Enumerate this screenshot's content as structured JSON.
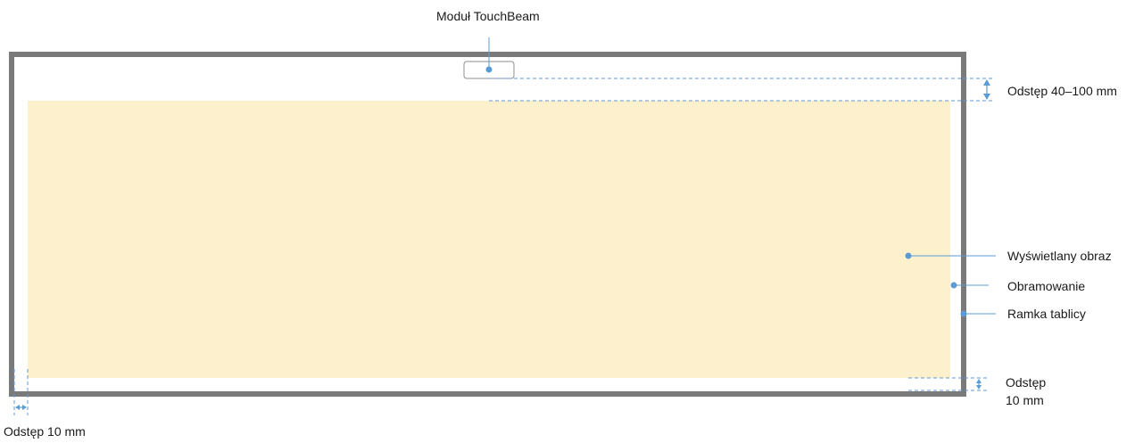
{
  "labels": {
    "touchbeam": "Moduł TouchBeam",
    "gap_top": "Odstęp 40–100 mm",
    "projected_image": "Wyświetlany obraz",
    "border": "Obramowanie",
    "board_frame": "Ramka tablicy",
    "gap_bottom_right_line1": "Odstęp",
    "gap_bottom_right_line2": "10 mm",
    "gap_bottom_left": "Odstęp 10 mm"
  },
  "colors": {
    "frame": "#7a7a7a",
    "image_fill": "#fdf0cd",
    "callout": "#5b9bd5",
    "text": "#1a1a1a"
  }
}
